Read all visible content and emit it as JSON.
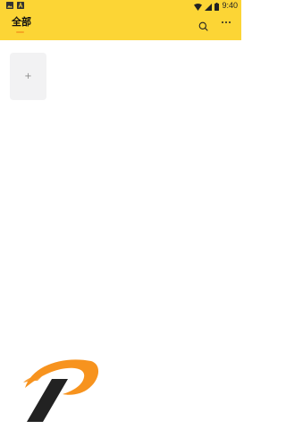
{
  "status_bar": {
    "time": "9:40",
    "icons": [
      "image-notification-icon",
      "a-notification-icon",
      "wifi-icon",
      "signal-icon",
      "battery-icon"
    ]
  },
  "header": {
    "tab_title": "全部",
    "accent_color": "#fcd535",
    "indicator_color": "#f5a623",
    "icons": [
      "search-icon",
      "more-icon"
    ]
  },
  "content": {
    "add_card_label": "+"
  },
  "colors": {
    "logo_orange": "#f7931e",
    "logo_dark": "#222222",
    "card_background": "#f2f2f3"
  }
}
